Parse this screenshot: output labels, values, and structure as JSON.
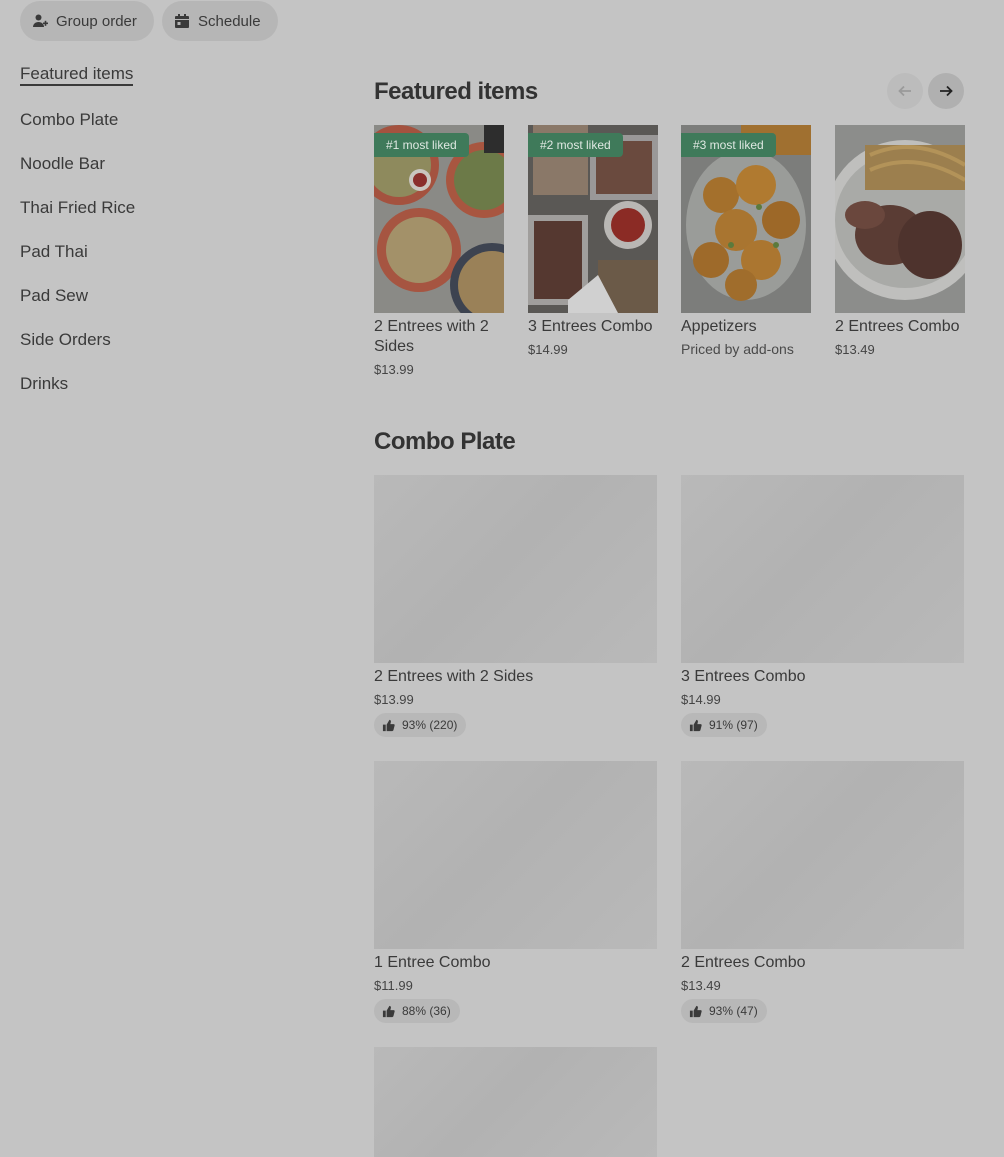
{
  "top_actions": {
    "group_order": "Group order",
    "schedule": "Schedule"
  },
  "sidebar": {
    "items": [
      {
        "label": "Featured items",
        "active": true
      },
      {
        "label": "Combo Plate"
      },
      {
        "label": "Noodle Bar"
      },
      {
        "label": "Thai Fried Rice"
      },
      {
        "label": "Pad Thai"
      },
      {
        "label": "Pad Sew"
      },
      {
        "label": "Side Orders"
      },
      {
        "label": "Drinks"
      }
    ]
  },
  "featured": {
    "title": "Featured items",
    "icons": {
      "prev": "arrow-left-icon",
      "next": "arrow-right-icon"
    },
    "items": [
      {
        "badge": "#1 most liked",
        "title": "2 Entrees with 2 Sides",
        "price": "$13.99"
      },
      {
        "badge": "#2 most liked",
        "title": "3 Entrees Combo",
        "price": "$14.99"
      },
      {
        "badge": "#3 most liked",
        "title": "Appetizers",
        "subtitle": "Priced by add-ons"
      },
      {
        "title": "2 Entrees Combo",
        "price": "$13.49"
      }
    ]
  },
  "combo_plate": {
    "title": "Combo Plate",
    "items": [
      {
        "title": "2 Entrees with 2 Sides",
        "price": "$13.99",
        "rating": "93% (220)"
      },
      {
        "title": "3 Entrees Combo",
        "price": "$14.99",
        "rating": "91% (97)"
      },
      {
        "title": "1 Entree Combo",
        "price": "$11.99",
        "rating": "88% (36)"
      },
      {
        "title": "2 Entrees Combo",
        "price": "$13.49",
        "rating": "93% (47)"
      }
    ]
  },
  "colors": {
    "overlay_background": "#c4c4c4",
    "badge_green": "#3f7a5a"
  }
}
